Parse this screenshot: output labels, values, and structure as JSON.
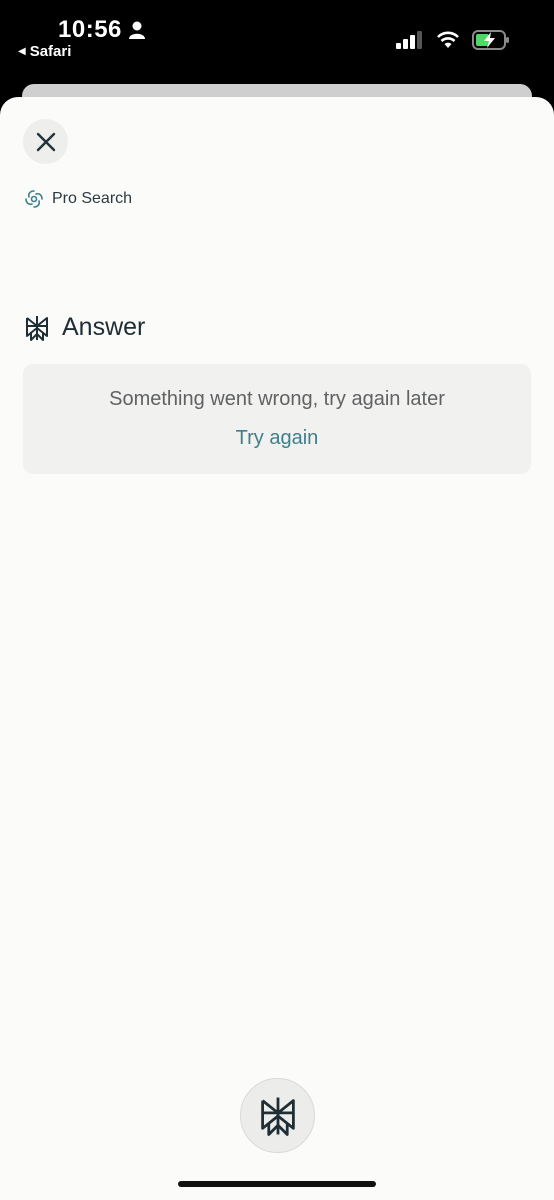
{
  "status_bar": {
    "time": "10:56",
    "back_app": "Safari"
  },
  "sheet": {
    "pro_search_label": "Pro Search",
    "answer_heading": "Answer",
    "error": {
      "message": "Something went wrong, try again later",
      "action": "Try again"
    }
  },
  "colors": {
    "accent": "#3f7f8c",
    "sheet_bg": "#fbfbf9",
    "card_bg": "#f1f2ef",
    "text_dark": "#1f2d35"
  }
}
